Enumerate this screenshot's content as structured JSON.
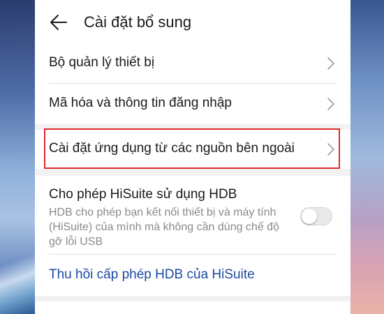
{
  "header": {
    "title": "Cài đặt bổ sung",
    "back_icon": "arrow-left-icon"
  },
  "settings": {
    "device_manager": "Bộ quản lý thiết bị",
    "encryption": "Mã hóa và thông tin đăng nhập",
    "external_sources": "Cài đặt ứng dụng từ các nguồn bên ngoài"
  },
  "hdb": {
    "title": "Cho phép HiSuite sử dụng HDB",
    "description": "HDB cho phép bạn kết nối thiết bị và máy tính (HiSuite) của mình mà không cần dùng chế độ gỡ lỗi USB",
    "toggle_on": false,
    "revoke_label": "Thu hồi cấp phép HDB của HiSuite"
  },
  "colors": {
    "highlight": "#e0282a",
    "link": "#1c4aa0"
  }
}
